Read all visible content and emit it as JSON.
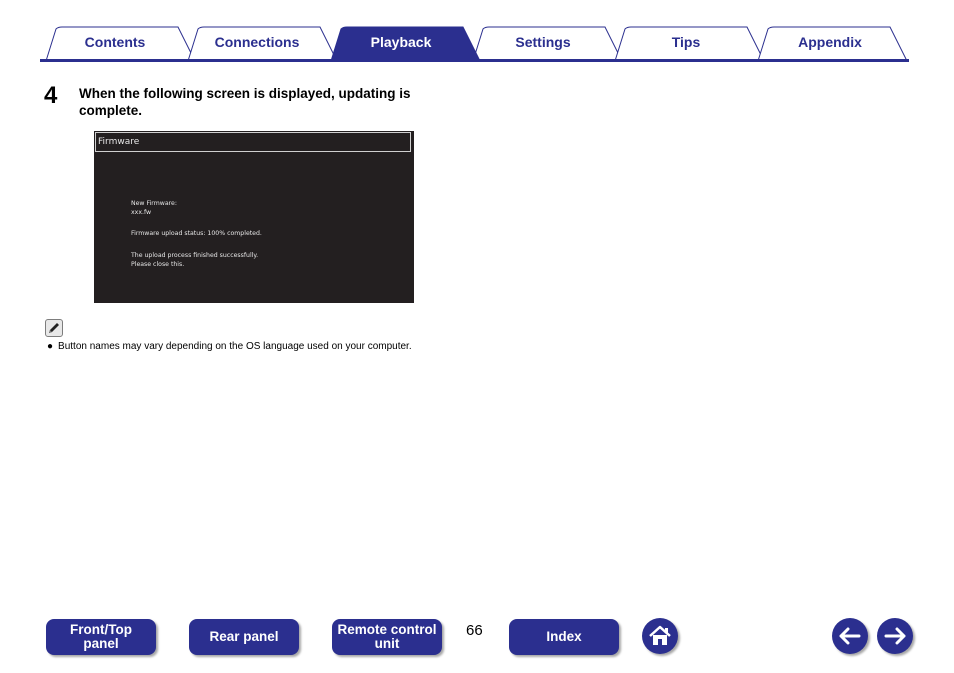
{
  "tabs": [
    {
      "label": "Contents",
      "active": false
    },
    {
      "label": "Connections",
      "active": false
    },
    {
      "label": "Playback",
      "active": true
    },
    {
      "label": "Settings",
      "active": false
    },
    {
      "label": "Tips",
      "active": false
    },
    {
      "label": "Appendix",
      "active": false
    }
  ],
  "step": {
    "number": "4",
    "text": "When the following screen is displayed, updating is complete."
  },
  "firmware_screen": {
    "title": "Firmware",
    "new_firmware_label": "New Firmware:",
    "file_name": "xxx.fw",
    "status": "Firmware upload status: 100% completed.",
    "finished": "The upload process finished successfully.",
    "close": "Please close this."
  },
  "note": {
    "icon": "pencil-icon",
    "text": "Button names may vary depending on the OS language used on your computer."
  },
  "bottom_nav": {
    "front_top_panel": "Front/Top\npanel",
    "rear_panel": "Rear panel",
    "remote_control_unit": "Remote control\nunit",
    "page_number": "66",
    "index": "Index",
    "home_icon": "home-icon",
    "back_icon": "arrow-left-icon",
    "forward_icon": "arrow-right-icon"
  },
  "colors": {
    "brand": "#2b2f8f",
    "tab_fill": "#ffffff",
    "screen_bg": "#231f20"
  }
}
